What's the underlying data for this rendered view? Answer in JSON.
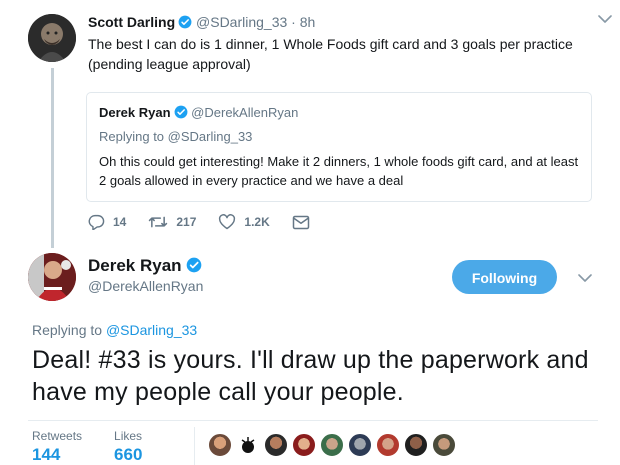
{
  "parent_tweet": {
    "name": "Scott Darling",
    "handle": "@SDarling_33",
    "time": "8h",
    "text": "The best I can do is 1 dinner, 1 Whole Foods gift card and 3 goals per practice (pending league approval)",
    "quoted": {
      "name": "Derek Ryan",
      "handle": "@DerekAllenRyan",
      "replying_prefix": "Replying to ",
      "replying_to": "@SDarling_33",
      "text": "Oh this could get interesting! Make it 2 dinners, 1 whole foods gift card, and at least 2 goals allowed in every practice and we have a deal"
    },
    "actions": {
      "replies": "14",
      "retweets": "217",
      "likes": "1.2K"
    }
  },
  "main_tweet": {
    "name": "Derek Ryan",
    "handle": "@DerekAllenRyan",
    "follow_label": "Following",
    "replying_prefix": "Replying to ",
    "replying_to": "@SDarling_33",
    "text": "Deal! #33 is yours. I'll draw up the paperwork and have my people call your people.",
    "stats": {
      "retweets_label": "Retweets",
      "retweets_value": "144",
      "likes_label": "Likes",
      "likes_value": "660"
    }
  },
  "colors": {
    "accent": "#1b95e0",
    "follow_button": "#4ba9e8",
    "muted": "#657786",
    "verified": "#1da1f2",
    "thread_line": "#c4cfd6"
  },
  "icons": [
    "verified-badge-icon",
    "chevron-down-icon",
    "reply-icon",
    "retweet-icon",
    "like-icon",
    "direct-message-icon"
  ]
}
